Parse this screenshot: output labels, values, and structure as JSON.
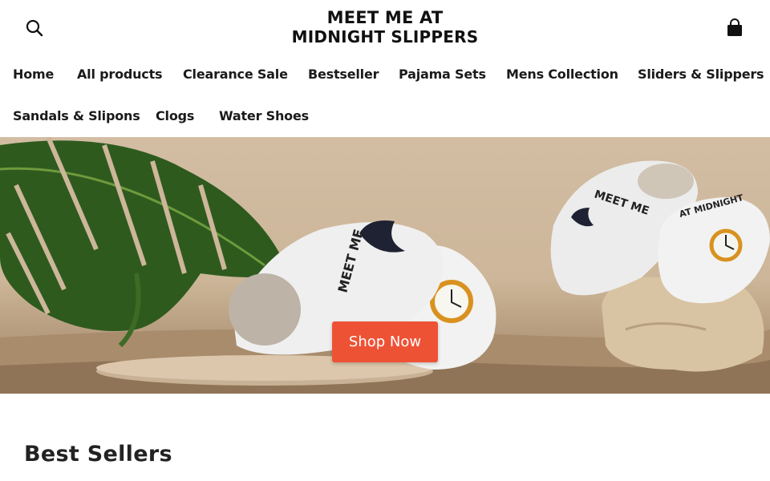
{
  "header": {
    "logo_line1": "MEET ME AT",
    "logo_line2": "MIDNIGHT SLIPPERS",
    "search_icon": "search-icon",
    "cart_icon": "shopping-bag-icon"
  },
  "nav": {
    "items": [
      {
        "label": "Home"
      },
      {
        "label": "All products"
      },
      {
        "label": "Clearance Sale"
      },
      {
        "label": "Bestseller"
      },
      {
        "label": "Pajama Sets"
      },
      {
        "label": "Mens Collection"
      },
      {
        "label": "Sliders & Slippers"
      },
      {
        "label": "Sandals & Slipons"
      },
      {
        "label": "Clogs"
      },
      {
        "label": "Water Shoes"
      }
    ]
  },
  "hero": {
    "cta_label": "Shop Now",
    "cta_color": "#ee5235",
    "slipper_text_1": "MEET ME",
    "slipper_text_2": "AT MIDNIGHT"
  },
  "best_sellers": {
    "title": "Best Sellers"
  }
}
